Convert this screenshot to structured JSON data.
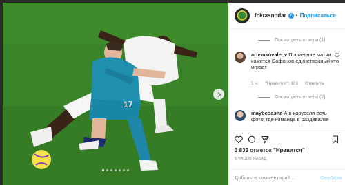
{
  "post": {
    "username": "fckrasnodar",
    "separator": "•",
    "follow_label": "Подписаться",
    "carousel": {
      "dot_count": 7,
      "active_index": 0
    }
  },
  "comments": {
    "view_replies_1": "Посмотреть ответы (1)",
    "comment_1": {
      "username": "artemkovale_v",
      "text": "Последние матчи кажется Сафонов единственный кто играет",
      "time": "5 ч.",
      "likes": "\"Нравится\": 160",
      "reply": "Ответить"
    },
    "view_replies_2": "Посмотреть ответы (2)",
    "comment_2": {
      "username": "maybedasha",
      "text": "А в карусели есть фото, где команда в раздевалке"
    }
  },
  "footer": {
    "likes": "3 833 отметок \"Нравится\"",
    "time": "5 ЧАСОВ НАЗАД",
    "comment_placeholder": "Добавьте комментарий...",
    "post_label": "Опублик"
  },
  "icons": {
    "heart": "heart-icon",
    "comment": "comment-icon",
    "share": "share-icon",
    "save": "bookmark-icon",
    "next": "chevron-right-icon",
    "verified": "verified-badge-icon"
  },
  "colors": {
    "accent": "#0095f6",
    "verified": "#3897f0",
    "muted": "#8e8e8e",
    "pitch": "#3a8429"
  }
}
